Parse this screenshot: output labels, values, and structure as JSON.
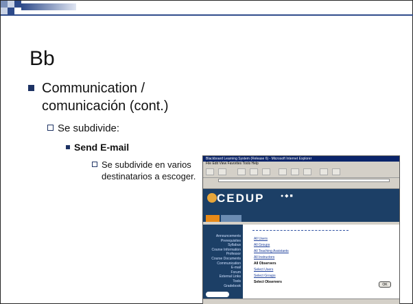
{
  "slide": {
    "title": "Bb",
    "bullet1": "Communication / comunicación (cont.)",
    "bullet2": "Se subdivide:",
    "bullet3": "Send E-mail",
    "bullet4": "Se subdivide en varios destinatarios a escoger."
  },
  "accent_color": "#1d3263",
  "screenshot": {
    "window_title": "Blackboard Learning System (Release 6) - Microsoft Internet Explorer",
    "menu": "File  Edit  View  Favorites  Tools  Help",
    "logo": "CEDUP",
    "side_menu": [
      "Announcements",
      "Prerequisites",
      "Syllabus",
      "Course Information",
      "Professor",
      "Course Documents",
      "Communication",
      "E-mail",
      "Forum",
      "External Links",
      "Tools",
      "Gradebook"
    ],
    "recipient_links": [
      "All Users",
      "All Groups",
      "All Teaching Assistants",
      "All Instructors",
      "All Observers",
      "Select Users",
      "Select Groups",
      "Select Observers"
    ],
    "ok_label": "OK"
  }
}
